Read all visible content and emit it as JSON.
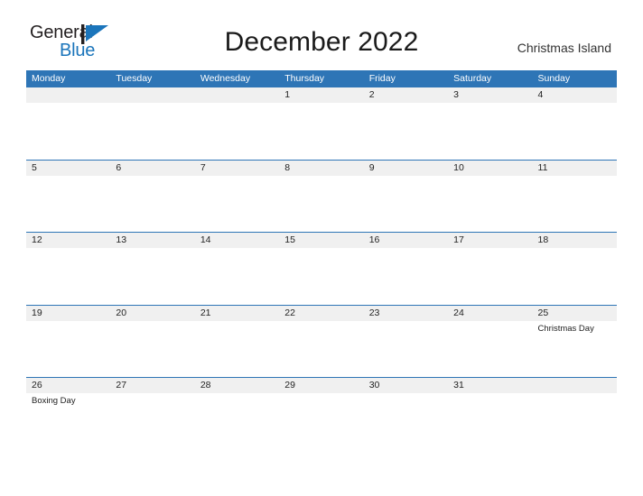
{
  "logo": {
    "word1": "General",
    "word2": "Blue",
    "flag_icon": "triangle-flag-icon",
    "color_dark": "#231f20",
    "color_blue": "#1b75bb"
  },
  "header": {
    "title": "December 2022",
    "location": "Christmas Island"
  },
  "theme": {
    "header_blue": "#2e75b6",
    "band_gray": "#f0f0f0",
    "text": "#222222"
  },
  "calendar": {
    "weekdays": [
      "Monday",
      "Tuesday",
      "Wednesday",
      "Thursday",
      "Friday",
      "Saturday",
      "Sunday"
    ],
    "weeks": [
      [
        {
          "num": "",
          "event": ""
        },
        {
          "num": "",
          "event": ""
        },
        {
          "num": "",
          "event": ""
        },
        {
          "num": "1",
          "event": ""
        },
        {
          "num": "2",
          "event": ""
        },
        {
          "num": "3",
          "event": ""
        },
        {
          "num": "4",
          "event": ""
        }
      ],
      [
        {
          "num": "5",
          "event": ""
        },
        {
          "num": "6",
          "event": ""
        },
        {
          "num": "7",
          "event": ""
        },
        {
          "num": "8",
          "event": ""
        },
        {
          "num": "9",
          "event": ""
        },
        {
          "num": "10",
          "event": ""
        },
        {
          "num": "11",
          "event": ""
        }
      ],
      [
        {
          "num": "12",
          "event": ""
        },
        {
          "num": "13",
          "event": ""
        },
        {
          "num": "14",
          "event": ""
        },
        {
          "num": "15",
          "event": ""
        },
        {
          "num": "16",
          "event": ""
        },
        {
          "num": "17",
          "event": ""
        },
        {
          "num": "18",
          "event": ""
        }
      ],
      [
        {
          "num": "19",
          "event": ""
        },
        {
          "num": "20",
          "event": ""
        },
        {
          "num": "21",
          "event": ""
        },
        {
          "num": "22",
          "event": ""
        },
        {
          "num": "23",
          "event": ""
        },
        {
          "num": "24",
          "event": ""
        },
        {
          "num": "25",
          "event": "Christmas Day"
        }
      ],
      [
        {
          "num": "26",
          "event": "Boxing Day"
        },
        {
          "num": "27",
          "event": ""
        },
        {
          "num": "28",
          "event": ""
        },
        {
          "num": "29",
          "event": ""
        },
        {
          "num": "30",
          "event": ""
        },
        {
          "num": "31",
          "event": ""
        },
        {
          "num": "",
          "event": ""
        }
      ]
    ]
  }
}
